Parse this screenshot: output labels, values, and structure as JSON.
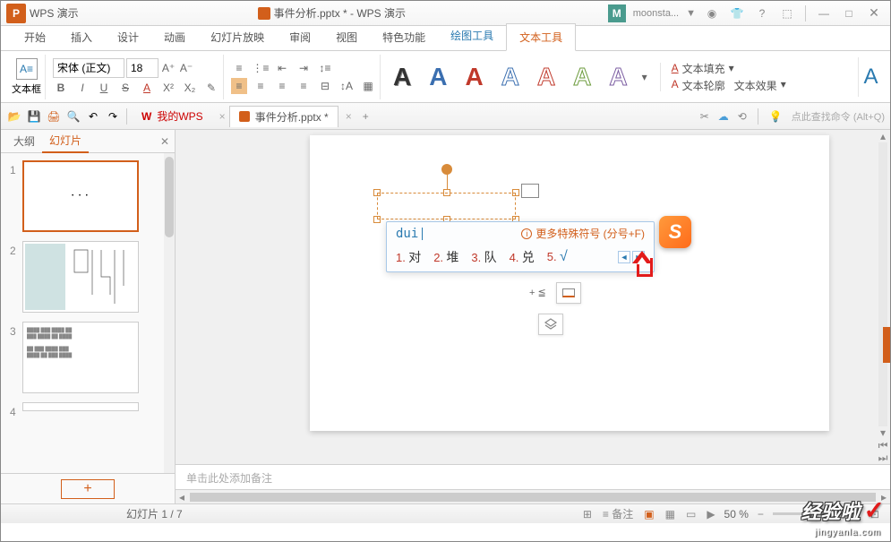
{
  "title": {
    "logo": "P",
    "app": "WPS 演示",
    "doc": "事件分析.pptx * - WPS 演示",
    "user_initial": "M",
    "user_name": "moonsta...",
    "dropdown": "▼",
    "help": "?",
    "min": "—",
    "max": "□",
    "close": "✕"
  },
  "menu": {
    "start": "开始",
    "insert": "插入",
    "design": "设计",
    "anim": "动画",
    "slideshow": "幻灯片放映",
    "review": "审阅",
    "view": "视图",
    "feature": "特色功能",
    "draw": "绘图工具",
    "text": "文本工具"
  },
  "ribbon": {
    "textbox": "文本框",
    "font": "宋体 (正文)",
    "size": "18",
    "bold": "B",
    "italic": "I",
    "underline": "U",
    "strike": "S",
    "fontcolor": "A",
    "sup": "X²",
    "sub": "X₂",
    "clear": "AB",
    "fill": "文本填充",
    "outline": "文本轮廓",
    "effect": "文本效果"
  },
  "docbar": {
    "mywps": "我的WPS",
    "doc": "事件分析.pptx *",
    "plus": "+",
    "quickcmd": "点此查找命令 (Alt+Q)"
  },
  "leftpanel": {
    "outline": "大纲",
    "slides": "幻灯片",
    "close": "✕",
    "add": "+",
    "n1": "1",
    "n2": "2",
    "n3": "3",
    "n4": "4"
  },
  "ime": {
    "input": "dui",
    "hint": "更多特殊符号 (分号+F)",
    "c1n": "1.",
    "c1": "对",
    "c2n": "2.",
    "c2": "堆",
    "c3n": "3.",
    "c3": "队",
    "c4n": "4.",
    "c4": "兑",
    "c5n": "5.",
    "c5": "√",
    "prev": "◄",
    "next": "►"
  },
  "float": {
    "plus_lte": "+ ≦",
    "layers": "❐"
  },
  "notes": "单击此处添加备注",
  "status": {
    "slide": "幻灯片 1 / 7",
    "notes": "备注",
    "zoom": "50 %"
  },
  "watermark": {
    "text": "经验啦",
    "url": "jingyanla.com"
  }
}
